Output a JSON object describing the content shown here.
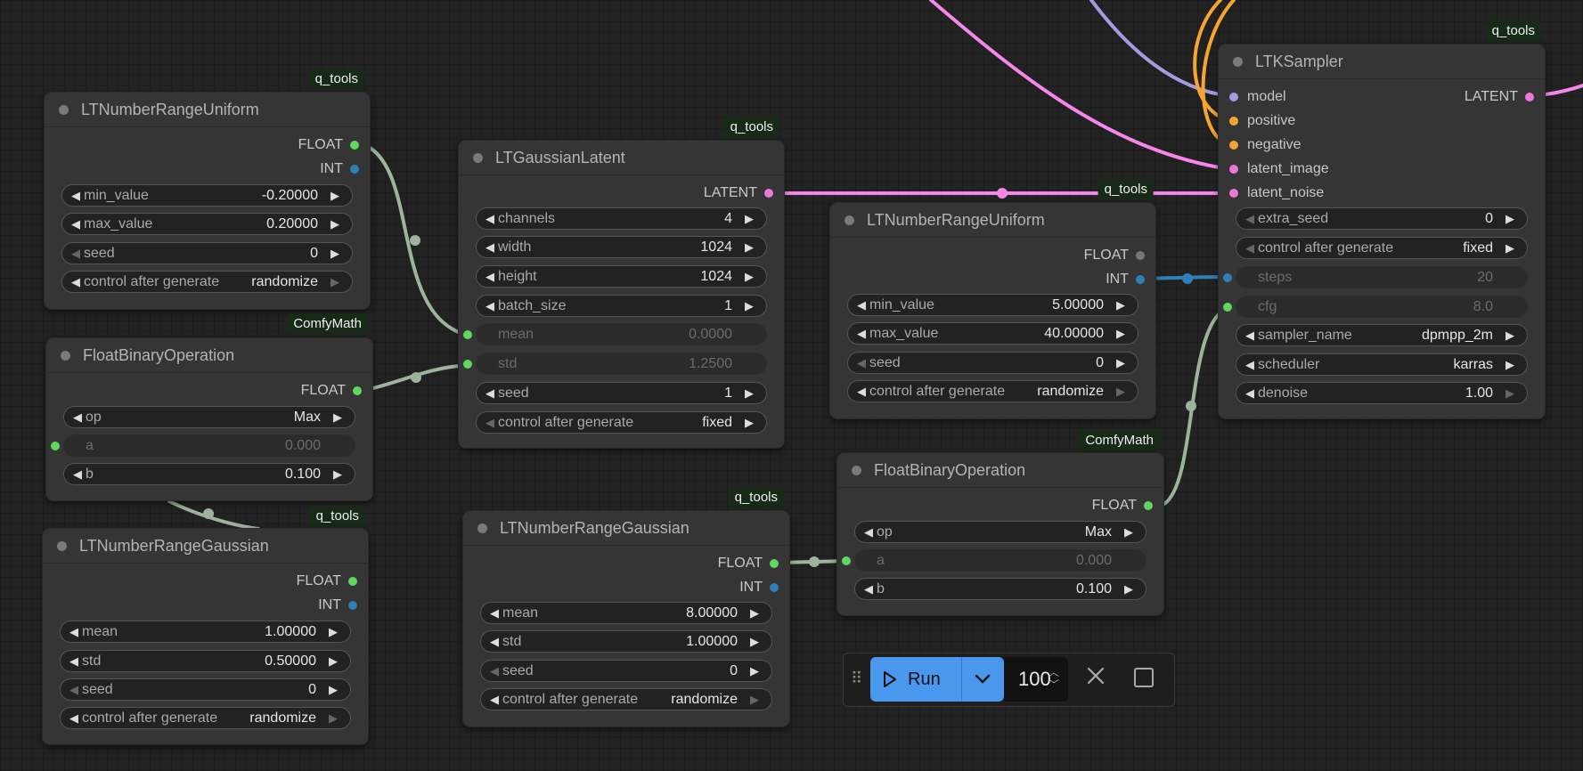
{
  "colors": {
    "float": "#60d860",
    "int": "#2f7fb8",
    "latent": "#e879d9",
    "conditioning": "#f6a530",
    "model": "#a79be0",
    "float_wire": "#9db39d",
    "latent_wire": "#f487e8",
    "int_wire": "#2f7fb8",
    "run_button": "#4a98ee"
  },
  "nodes": {
    "n1": {
      "badge": "q_tools",
      "title": "LTNumberRangeUniform",
      "outputs": [
        "FLOAT",
        "INT"
      ],
      "widgets": [
        {
          "label": "min_value",
          "value": "-0.20000"
        },
        {
          "label": "max_value",
          "value": "0.20000"
        },
        {
          "label": "seed",
          "value": "0"
        },
        {
          "label": "control after generate",
          "value": "randomize"
        }
      ]
    },
    "n2": {
      "badge": "ComfyMath",
      "title": "FloatBinaryOperation",
      "outputs": [
        "FLOAT"
      ],
      "widgets": [
        {
          "label": "op",
          "value": "Max"
        },
        {
          "label": "a",
          "value": "0.000"
        },
        {
          "label": "b",
          "value": "0.100"
        }
      ]
    },
    "n3": {
      "badge": "q_tools",
      "title": "LTNumberRangeGaussian",
      "outputs": [
        "FLOAT",
        "INT"
      ],
      "widgets": [
        {
          "label": "mean",
          "value": "1.00000"
        },
        {
          "label": "std",
          "value": "0.50000"
        },
        {
          "label": "seed",
          "value": "0"
        },
        {
          "label": "control after generate",
          "value": "randomize"
        }
      ]
    },
    "n4": {
      "badge": "q_tools",
      "title": "LTGaussianLatent",
      "outputs": [
        "LATENT"
      ],
      "widgets": [
        {
          "label": "channels",
          "value": "4"
        },
        {
          "label": "width",
          "value": "1024"
        },
        {
          "label": "height",
          "value": "1024"
        },
        {
          "label": "batch_size",
          "value": "1"
        },
        {
          "label": "mean",
          "value": "0.0000"
        },
        {
          "label": "std",
          "value": "1.2500"
        },
        {
          "label": "seed",
          "value": "1"
        },
        {
          "label": "control after generate",
          "value": "fixed"
        }
      ]
    },
    "n5": {
      "badge": "q_tools",
      "title": "LTNumberRangeGaussian",
      "outputs": [
        "FLOAT",
        "INT"
      ],
      "widgets": [
        {
          "label": "mean",
          "value": "8.00000"
        },
        {
          "label": "std",
          "value": "1.00000"
        },
        {
          "label": "seed",
          "value": "0"
        },
        {
          "label": "control after generate",
          "value": "randomize"
        }
      ]
    },
    "n6": {
      "badge": "q_tools",
      "title": "LTNumberRangeUniform",
      "outputs": [
        "FLOAT",
        "INT"
      ],
      "widgets": [
        {
          "label": "min_value",
          "value": "5.00000"
        },
        {
          "label": "max_value",
          "value": "40.00000"
        },
        {
          "label": "seed",
          "value": "0"
        },
        {
          "label": "control after generate",
          "value": "randomize"
        }
      ]
    },
    "n7": {
      "badge": "ComfyMath",
      "title": "FloatBinaryOperation",
      "outputs": [
        "FLOAT"
      ],
      "widgets": [
        {
          "label": "op",
          "value": "Max"
        },
        {
          "label": "a",
          "value": "0.000"
        },
        {
          "label": "b",
          "value": "0.100"
        }
      ]
    },
    "n8": {
      "badge": "q_tools",
      "title": "LTKSampler",
      "outputs": [
        "LATENT"
      ],
      "inputs": [
        "model",
        "positive",
        "negative",
        "latent_image",
        "latent_noise"
      ],
      "widgets": [
        {
          "label": "extra_seed",
          "value": "0"
        },
        {
          "label": "control after generate",
          "value": "fixed"
        },
        {
          "label": "steps",
          "value": "20"
        },
        {
          "label": "cfg",
          "value": "8.0"
        },
        {
          "label": "sampler_name",
          "value": "dpmpp_2m"
        },
        {
          "label": "scheduler",
          "value": "karras"
        },
        {
          "label": "denoise",
          "value": "1.00"
        }
      ]
    }
  },
  "runbar": {
    "run_label": "Run",
    "count": "100"
  }
}
